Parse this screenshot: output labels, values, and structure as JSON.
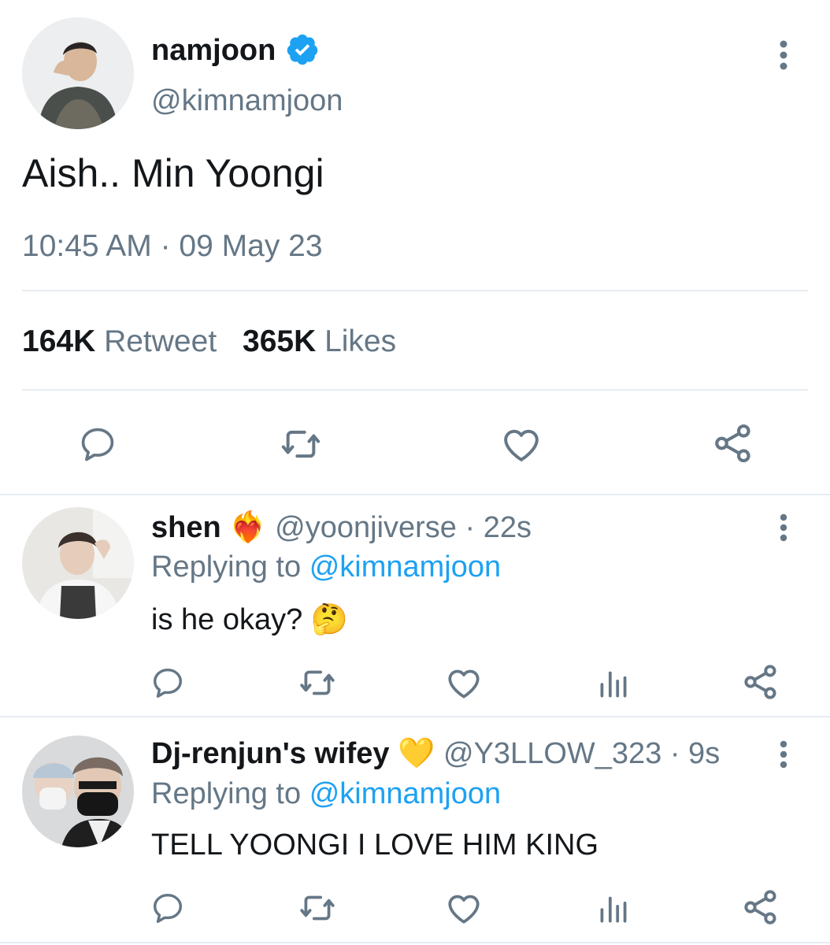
{
  "tweet": {
    "display_name": "namjoon",
    "handle": "@kimnamjoon",
    "text": "Aish.. Min Yoongi",
    "timestamp": "10:45 AM · 09 May 23",
    "retweet_count": "164K",
    "retweet_label": "Retweet",
    "like_count": "365K",
    "like_label": "Likes"
  },
  "replies": [
    {
      "display_name": "shen",
      "badge_emoji": "❤️‍🔥",
      "handle": "@yoonjiverse",
      "time": "· 22s",
      "replying_prefix": "Replying to",
      "replying_handle": "@kimnamjoon",
      "text": "is he okay?",
      "text_emoji": "🤔"
    },
    {
      "display_name": "Dj-renjun's wifey",
      "badge_emoji": "💛",
      "handle": "@Y3LLOW_323",
      "time": "· 9s",
      "replying_prefix": "Replying to",
      "replying_handle": "@kimnamjoon",
      "text": "TELL YOONGI I LOVE HIM KING",
      "text_emoji": ""
    }
  ],
  "colors": {
    "text": "#14171a",
    "secondary": "#657786",
    "accent": "#1da1f2",
    "divider": "#e6ecf0"
  },
  "icons": [
    "verified-badge-icon",
    "more-options-icon",
    "reply-icon",
    "retweet-icon",
    "like-icon",
    "share-icon",
    "analytics-icon"
  ]
}
